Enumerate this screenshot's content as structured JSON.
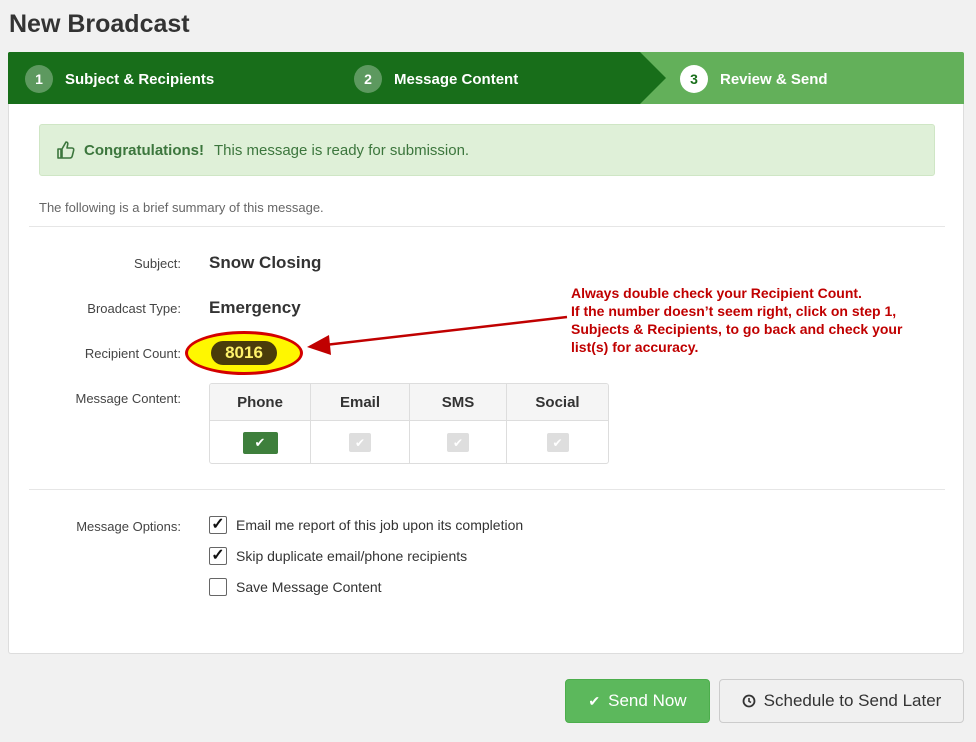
{
  "page": {
    "title": "New Broadcast"
  },
  "wizard": {
    "steps": [
      {
        "num": "1",
        "label": "Subject & Recipients"
      },
      {
        "num": "2",
        "label": "Message Content"
      },
      {
        "num": "3",
        "label": "Review & Send"
      }
    ],
    "active_step": 3
  },
  "alert": {
    "strong": "Congratulations!",
    "text": "This message is ready for submission.",
    "icon": "thumbs-up-icon"
  },
  "summary": {
    "intro": "The following is a brief summary of this message."
  },
  "details": {
    "subject_label": "Subject:",
    "subject_value": "Snow Closing",
    "type_label": "Broadcast Type:",
    "type_value": "Emergency",
    "count_label": "Recipient Count:",
    "count_value": "8016",
    "content_label": "Message Content:"
  },
  "annotation": {
    "line1": "Always double check your Recipient Count.",
    "line2": "If the number doesn’t seem right, click on step 1,",
    "line3": "Subjects & Recipients, to go back and check your",
    "line4": "list(s) for accuracy."
  },
  "message_content": {
    "columns": [
      "Phone",
      "Email",
      "SMS",
      "Social"
    ],
    "enabled": [
      true,
      false,
      false,
      false
    ]
  },
  "options": {
    "label": "Message Options:",
    "items": [
      {
        "label": "Email me report of this job upon its completion",
        "checked": true
      },
      {
        "label": "Skip duplicate email/phone recipients",
        "checked": true
      },
      {
        "label": "Save Message Content",
        "checked": false
      }
    ]
  },
  "actions": {
    "send_now": "Send Now",
    "schedule": "Schedule to Send Later"
  },
  "colors": {
    "wizard_dark": "#186e1a",
    "wizard_light": "#63b05a",
    "annotation_red": "#c00000",
    "send_green": "#5cb85c"
  }
}
